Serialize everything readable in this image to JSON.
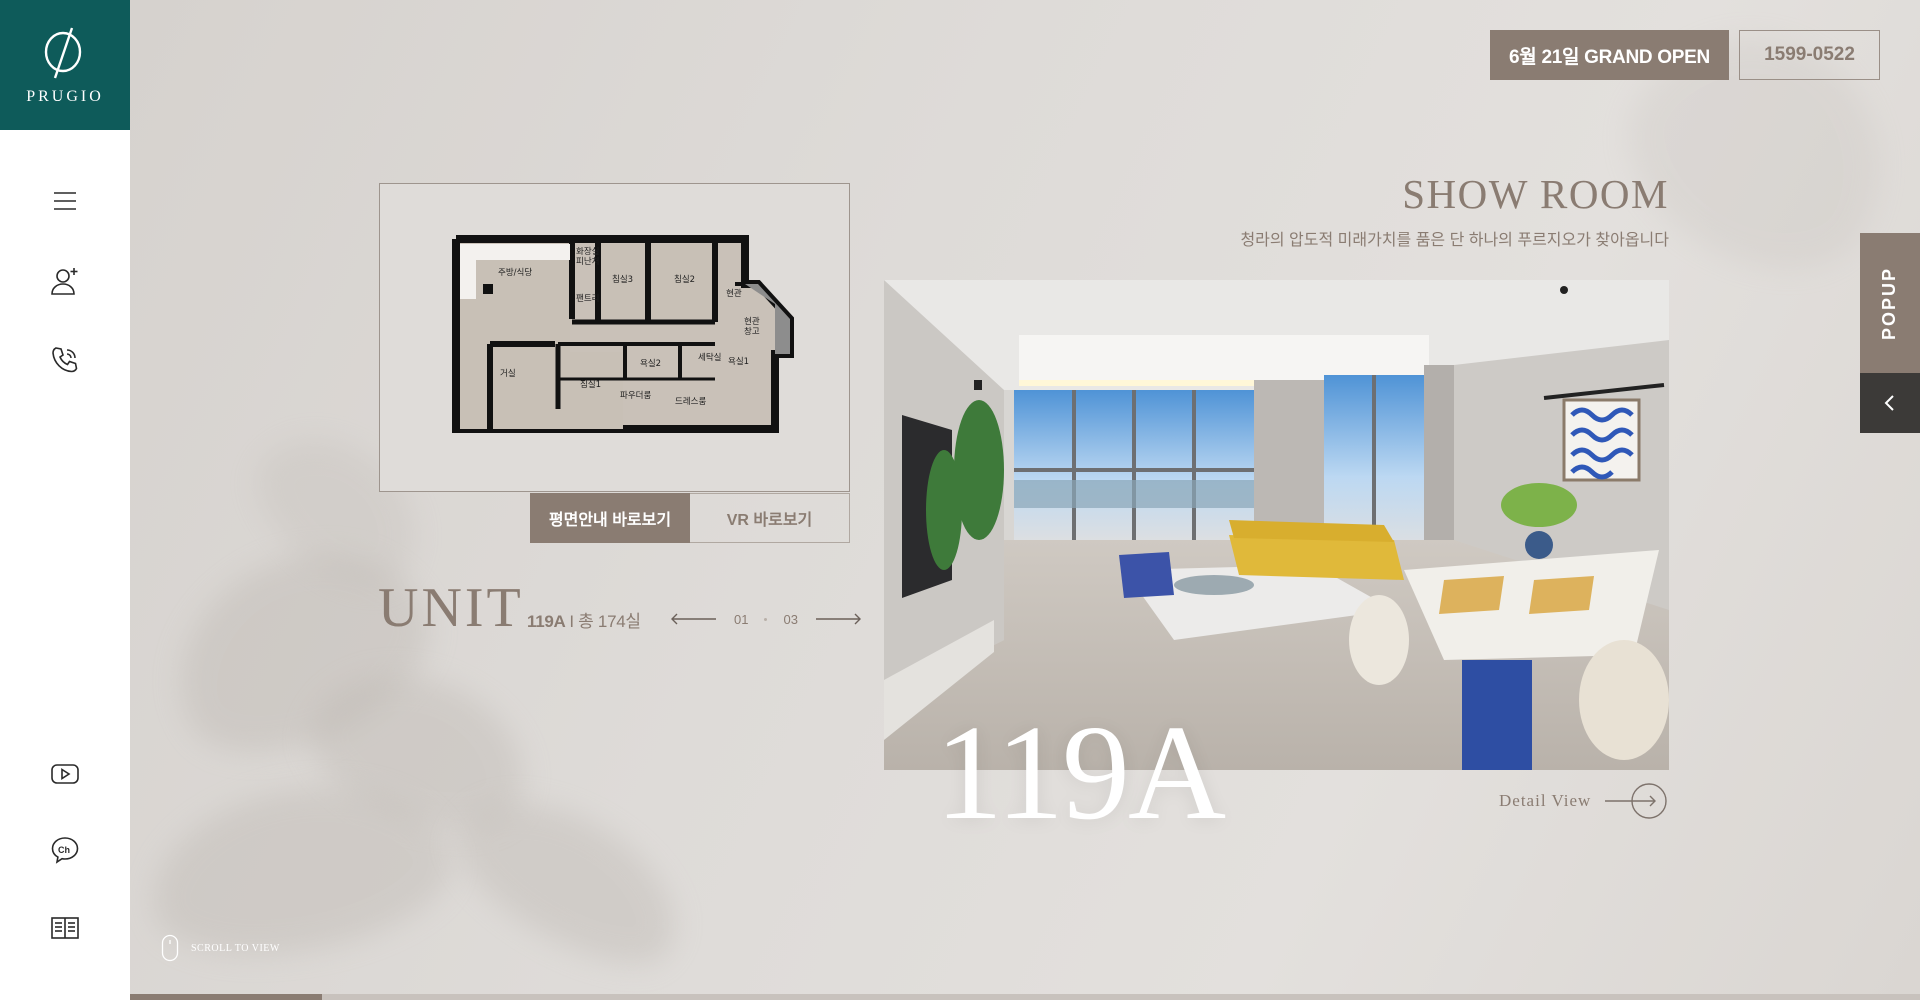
{
  "brand": {
    "name": "PRUGIO",
    "color": "#0e5b5a"
  },
  "sidebar": {
    "icons": [
      "menu-icon",
      "add-user-icon",
      "phone-call-icon",
      "youtube-icon",
      "kakao-channel-icon",
      "book-icon"
    ]
  },
  "header": {
    "grand_open": "6월 21일 GRAND OPEN",
    "phone": "1599-0522"
  },
  "popup": {
    "label": "POPUP"
  },
  "floor_plan": {
    "rooms": [
      "주방/식당",
      "화장실\n피난처",
      "팬트리",
      "침실3",
      "침실2",
      "현관",
      "현관\n창고",
      "거실",
      "침실1",
      "욕실2",
      "세탁실",
      "욕실1",
      "파우더룸",
      "드레스룸"
    ],
    "buttons": {
      "plan": "평면안내 바로보기",
      "vr": "VR 바로보기"
    }
  },
  "unit": {
    "title": "UNIT",
    "type": "119A",
    "total": "I 총 174실",
    "current": "01",
    "total_pages": "03"
  },
  "showroom": {
    "title": "SHOW ROOM",
    "subtitle": "청라의 압도적 미래가치를 품은 단 하나의 푸르지오가 찾아옵니다",
    "big_label": "119A",
    "detail": "Detail View"
  },
  "scroll": {
    "label": "SCROLL TO VIEW"
  },
  "progress": {
    "value": 0.107
  },
  "colors": {
    "accent": "#8a7c72",
    "dark": "#3c3a38"
  }
}
